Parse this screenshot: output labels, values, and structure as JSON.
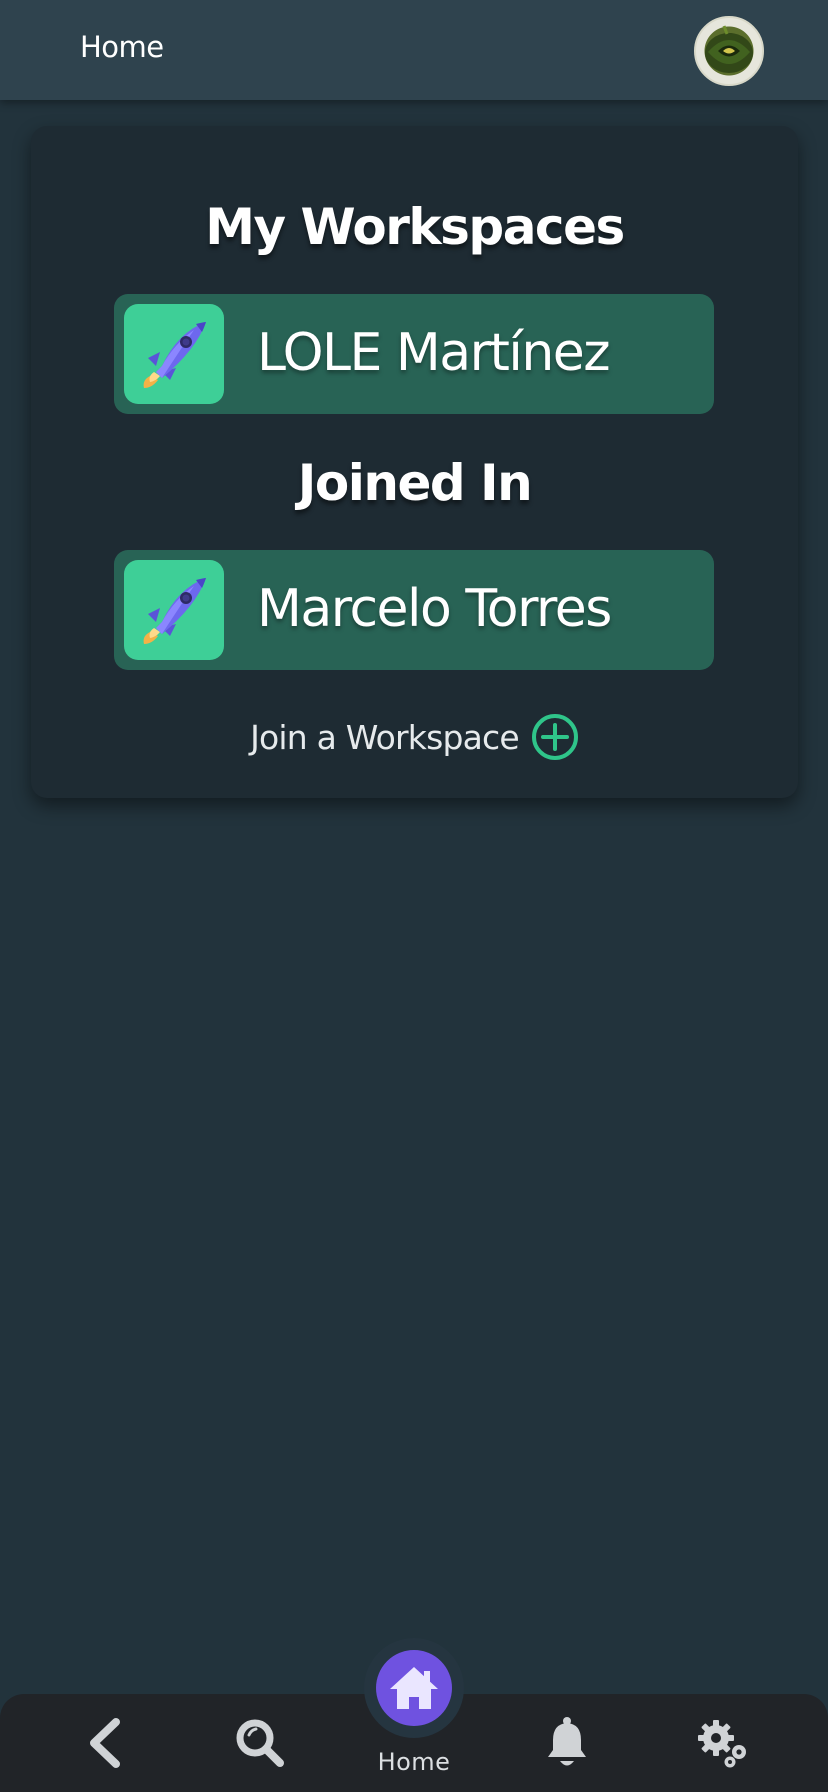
{
  "header": {
    "title": "Home",
    "avatar_icon": "user-avatar"
  },
  "workspaces": {
    "my_title": "My Workspaces",
    "my_items": [
      {
        "name": "LOLE Martínez",
        "icon": "rocket-icon"
      }
    ],
    "joined_title": "Joined In",
    "joined_items": [
      {
        "name": "Marcelo Torres",
        "icon": "rocket-icon"
      }
    ],
    "join_label": "Join a Workspace",
    "join_icon": "plus-circle-icon"
  },
  "bottom_nav": {
    "items": [
      {
        "icon": "back-arrow-icon"
      },
      {
        "icon": "search-icon"
      },
      {
        "icon": "home-icon",
        "label": "Home",
        "active": true
      },
      {
        "icon": "bell-icon"
      },
      {
        "icon": "settings-gears-icon"
      }
    ]
  },
  "colors": {
    "background": "#22333c",
    "header": "#2f434e",
    "card": "#1e2b33",
    "workspace_item": "#286355",
    "workspace_icon_bg": "#3ecf97",
    "accent_green": "#2fc58a",
    "home_active": "#6f52e0",
    "nav_bar": "#212428"
  }
}
